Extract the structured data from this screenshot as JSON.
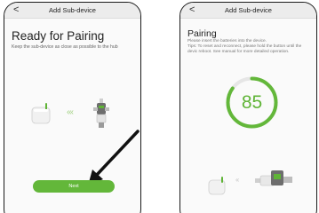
{
  "left_screen": {
    "header": {
      "back_icon": "back-chevron-icon",
      "title": "Add Sub-device"
    },
    "title": "Ready for Pairing",
    "subtitle": "Keep the sub-device as close as possible to the hub",
    "chevrons": "‹‹‹",
    "next_button_label": "Next"
  },
  "right_screen": {
    "header": {
      "back_icon": "back-chevron-icon",
      "title": "Add Sub-device"
    },
    "title": "Pairing",
    "description": "Please insert the batteries into the device.\nTips: To reset and reconnect, please hold the button until the devic reboot. See manual for more detailed operation.",
    "progress": 85,
    "chevrons": "‹‹"
  },
  "colors": {
    "accent_green": "#63b73a",
    "ring_track": "#e6e6e6"
  }
}
